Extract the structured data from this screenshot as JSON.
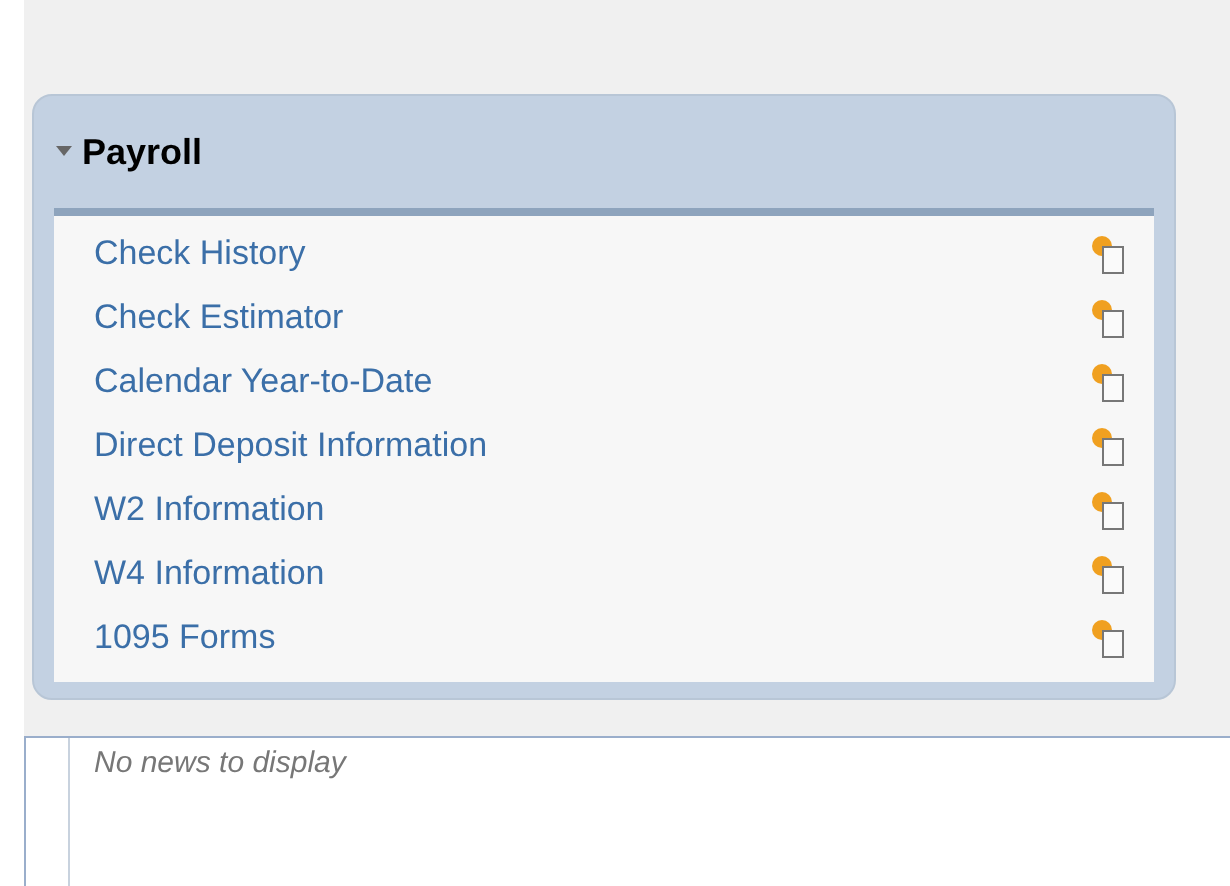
{
  "panel": {
    "title": "Payroll",
    "expanded": true,
    "items": [
      {
        "label": "Check History"
      },
      {
        "label": "Check Estimator"
      },
      {
        "label": "Calendar Year-to-Date"
      },
      {
        "label": "Direct Deposit Information"
      },
      {
        "label": "W2 Information"
      },
      {
        "label": "W4 Information"
      },
      {
        "label": "1095 Forms"
      }
    ]
  },
  "news": {
    "message": "No news to display"
  }
}
